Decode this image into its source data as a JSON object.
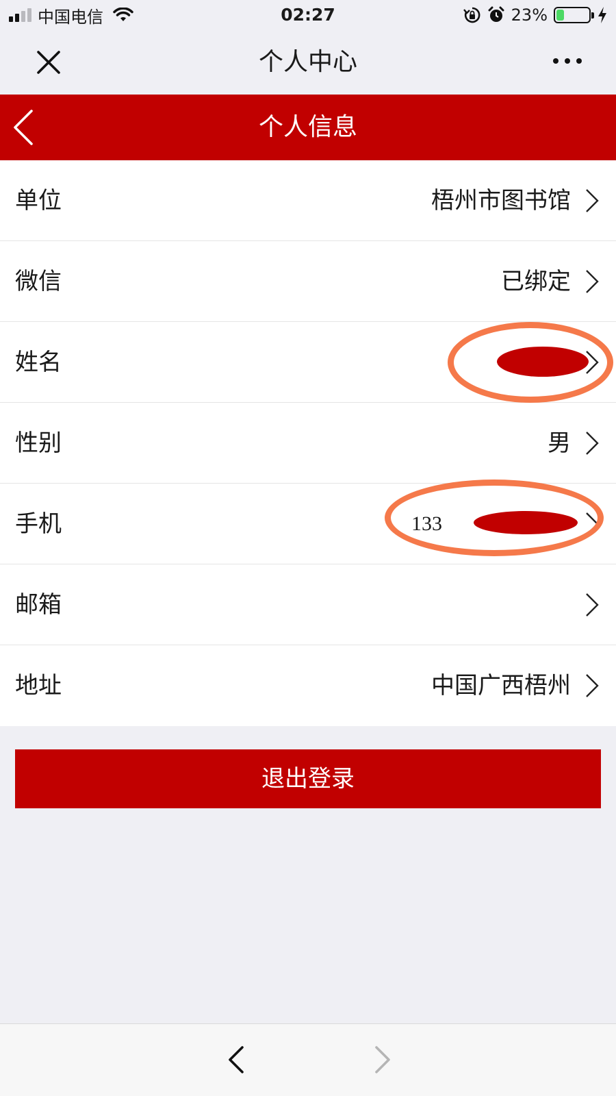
{
  "status_bar": {
    "carrier": "中国电信",
    "time": "02:27",
    "battery_percent": "23%",
    "battery_level": 0.23,
    "icons": [
      "signal-icon",
      "wifi-icon",
      "rotation-lock-icon",
      "alarm-icon",
      "battery-icon",
      "charging-icon"
    ]
  },
  "nav_bar": {
    "title": "个人中心",
    "close_icon": "close-icon",
    "more_icon": "more-icon"
  },
  "page_header": {
    "title": "个人信息",
    "back_icon": "chevron-left-icon"
  },
  "info_list": [
    {
      "label": "单位",
      "value": "梧州市图书馆"
    },
    {
      "label": "微信",
      "value": "已绑定"
    },
    {
      "label": "姓名",
      "value": "",
      "redacted": true
    },
    {
      "label": "性别",
      "value": "男"
    },
    {
      "label": "手机",
      "value": "133",
      "redacted": true
    },
    {
      "label": "邮箱",
      "value": ""
    },
    {
      "label": "地址",
      "value": "中国广西梧州"
    }
  ],
  "logout": {
    "label": "退出登录"
  },
  "toolbar": {
    "back_icon": "chevron-left-icon",
    "forward_icon": "chevron-right-icon"
  },
  "colors": {
    "brand_red": "#c10000",
    "annotation_orange": "#f5794a",
    "background": "#efeff4",
    "battery_green": "#4cd964"
  }
}
